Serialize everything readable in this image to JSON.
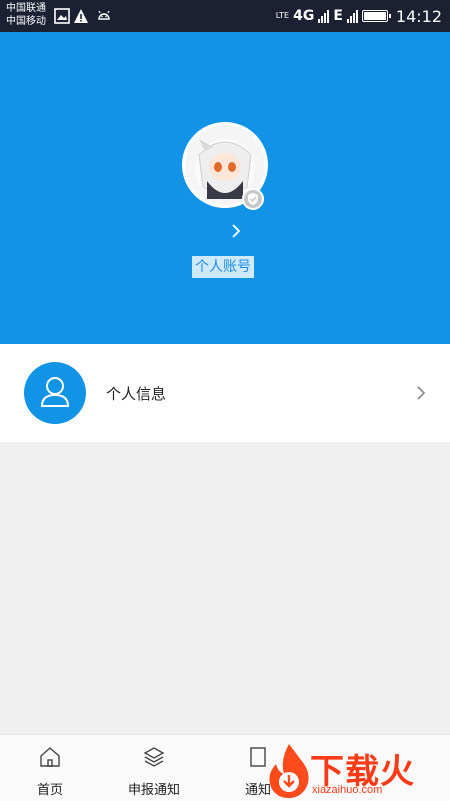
{
  "status_bar": {
    "carrier_1": "中国联通",
    "carrier_2": "中国移动",
    "network_lte": "LTE",
    "network_4g": "4G",
    "network_e": "E",
    "time": "14:12"
  },
  "profile": {
    "account_label": "个人账号"
  },
  "menu": {
    "personal_info_label": "个人信息"
  },
  "tabbar": {
    "items": [
      {
        "label": "首页",
        "icon": "home-icon"
      },
      {
        "label": "申报通知",
        "icon": "layers-icon"
      },
      {
        "label": "通知",
        "icon": "document-icon"
      }
    ]
  },
  "watermark": {
    "brand": "下载火",
    "url": "xiazaihuo.com"
  },
  "colors": {
    "primary": "#1193e6",
    "status_bar": "#1b2133",
    "watermark": "#ff3b17"
  }
}
